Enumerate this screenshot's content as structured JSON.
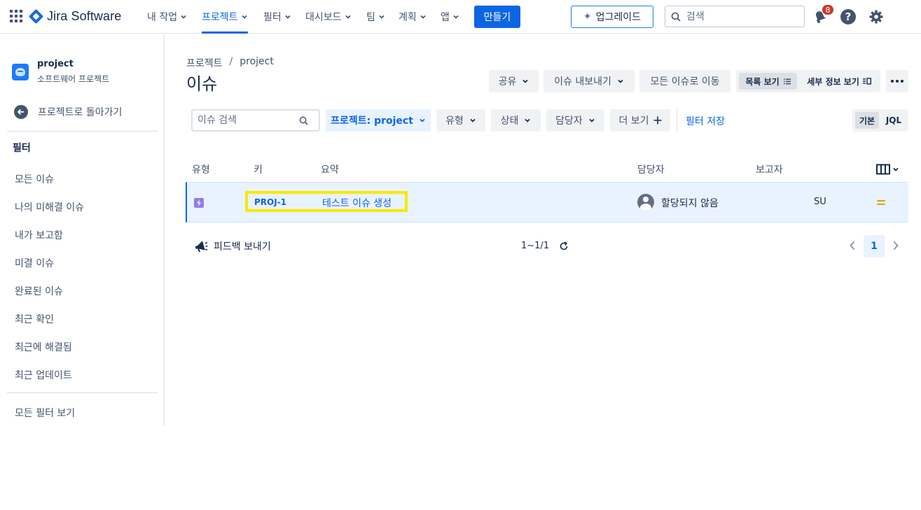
{
  "app": {
    "name": "Jira Software"
  },
  "topnav": {
    "items": [
      {
        "label": "내 작업"
      },
      {
        "label": "프로젝트"
      },
      {
        "label": "필터"
      },
      {
        "label": "대시보드"
      },
      {
        "label": "팀"
      },
      {
        "label": "계획"
      },
      {
        "label": "앱"
      }
    ],
    "create_label": "만들기",
    "upgrade_label": "업그레이드",
    "search_placeholder": "검색",
    "notification_count": "8",
    "help_label": "?"
  },
  "sidebar": {
    "project_name": "project",
    "project_type": "소프트웨어 프로젝트",
    "back_label": "프로젝트로 돌아가기",
    "filters_heading": "필터",
    "items": [
      {
        "label": "모든 이슈"
      },
      {
        "label": "나의 미해결 이슈"
      },
      {
        "label": "내가 보고함"
      },
      {
        "label": "미결 이슈"
      },
      {
        "label": "완료된 이슈"
      },
      {
        "label": "최근 확인"
      },
      {
        "label": "최근에 해결됨"
      },
      {
        "label": "최근 업데이트"
      }
    ],
    "all_filters_label": "모든 필터 보기"
  },
  "main": {
    "breadcrumb": [
      "프로젝트",
      "project"
    ],
    "breadcrumb_sep": "/",
    "title": "이슈",
    "toolbar": {
      "share": "공유",
      "export": "이슈 내보내기",
      "goto_all": "모든 이슈로 이동",
      "list_view": "목록 보기",
      "detail_view": "세부 정보 보기"
    },
    "filters": {
      "search_placeholder": "이슈 검색",
      "project": "프로젝트: project",
      "type": "유형",
      "status": "상태",
      "assignee": "담당자",
      "more": "더 보기",
      "save": "필터 저장",
      "mode_basic": "기본",
      "mode_jql": "JQL"
    },
    "columns": {
      "type": "유형",
      "key": "키",
      "summary": "요약",
      "assignee": "담당자",
      "reporter": "보고자"
    },
    "rows": [
      {
        "key": "PROJ-1",
        "summary": "테스트 이슈 생성",
        "assignee": "할당되지 않음",
        "reporter": "SU",
        "priority": "medium"
      }
    ],
    "feedback_label": "피드백 보내기",
    "count_label": "1~1/1",
    "current_page": "1"
  },
  "colors": {
    "primary": "#0c66e4",
    "highlight": "#f5ea00",
    "priority_medium": "#e2a203",
    "badge": "#c9372c"
  }
}
